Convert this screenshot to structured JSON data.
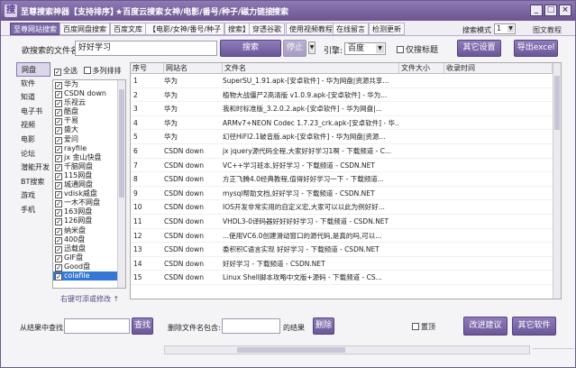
{
  "app": {
    "title": "至尊搜索神器【支持排序】",
    "menu": [
      "★百度云搜索",
      "女神/电影/番号/种子/磁力链接",
      "搜索"
    ],
    "window_controls": [
      "_",
      "□",
      "×"
    ]
  },
  "tabs": [
    "至尊网站搜索",
    "百度网盘搜索",
    "百度文库",
    "【电影/女神/番号/种子",
    "搜索】",
    "穿透谷歌",
    "使用视频教程",
    "在线留言",
    "检测更新"
  ],
  "search_mode": {
    "label": "搜索模式",
    "value": "1"
  },
  "tutorial_label": "图文教程",
  "search": {
    "label": "欲搜索的文件名:",
    "value": "好好学习",
    "button": "搜索",
    "second_button": "停止",
    "engine_label": "引擎:",
    "engine_value": "百度",
    "header_only_label": "仅搜标题",
    "other_settings": "其它设置",
    "export_excel": "导出excel"
  },
  "left_nav": [
    "网盘",
    "软件",
    "知道",
    "电子书",
    "视频",
    "电影",
    "论坛",
    "潜能开发",
    "BT搜索",
    "游戏",
    "手机"
  ],
  "site_panel": {
    "select_all": "全选",
    "multi_tag": "多列排排",
    "hint": "右键可添或修改 ↑"
  },
  "sites": [
    "华为",
    "CSDN down",
    "乐视云",
    "酷盘",
    "干易",
    "盛大",
    "爱问",
    "rayfile",
    "jx 金山快盘",
    "千脑网盘",
    "115网盘",
    "城通网盘",
    "vdisk威盘",
    "一木不网盘",
    "163网盘",
    "126网盘",
    "纳米盘",
    "400盘",
    "迅载盘",
    "GIF盘",
    "Good盘",
    "colafile"
  ],
  "table": {
    "headers": [
      "序号",
      "网站名",
      "文件名",
      "文件大小",
      "收录时间"
    ],
    "rows": [
      [
        "1",
        "华为",
        "SuperSU_1.91.apk-[安卓软件] - 华为网盘|资源共享..."
      ],
      [
        "2",
        "华为",
        "植物大战僵尸2高清版 v1.0.9.apk-[安卓软件] - 华为..."
      ],
      [
        "3",
        "华为",
        "我和时标准版_3.2.0.2.apk-[安卓软件] - 华为网盘|..."
      ],
      [
        "4",
        "华为",
        "ARMv7+NEON Codec 1.7.23_crk.apk-[安卓软件] - 华..."
      ],
      [
        "5",
        "华为",
        "幻径HiFI2.1破音版.apk-[安卓软件] - 华为网盘|资源..."
      ],
      [
        "6",
        "CSDN down",
        "jx jquery源代码全程,大家好好学习1啊 - 下载频道 - C..."
      ],
      [
        "7",
        "CSDN down",
        "VC++学习班本,好好学习 - 下载频道 - CSDN.NET"
      ],
      [
        "8",
        "CSDN down",
        "方正飞腾4.0经典教程,值得好好学习一下 - 下载频道..."
      ],
      [
        "9",
        "CSDN down",
        "mysql帮助文档,好好学习 - 下载频道 - CSDN.NET"
      ],
      [
        "10",
        "CSDN down",
        "IOS开发非常实用的自定义宏,大家可以以此为例好好..."
      ],
      [
        "11",
        "CSDN down",
        "VHDL3-0译码器好好好好学习 - 下载频道 - CSDN.NET"
      ],
      [
        "12",
        "CSDN down",
        "...使用VC6.0创建滑动窗口的源代码,是真的吗,可以..."
      ],
      [
        "13",
        "CSDN down",
        "委积积C语言实现 好好学习 - 下载频道 - CSDN.NET"
      ],
      [
        "14",
        "CSDN down",
        "好好学习 - 下载频道 - CSDN.NET"
      ],
      [
        "15",
        "CSDN down",
        "Linux Shell脚本攻略中文版+源码 - 下载频道 - CS..."
      ]
    ]
  },
  "bottom": {
    "filter_label": "从结果中查找:",
    "find_button": "查找",
    "delete_label": "删除文件名包含:",
    "results_label": "的结果",
    "delete_button": "删除",
    "top_label": "置顶",
    "feedback_button": "改进建议",
    "other_software_button": "其它软件"
  }
}
